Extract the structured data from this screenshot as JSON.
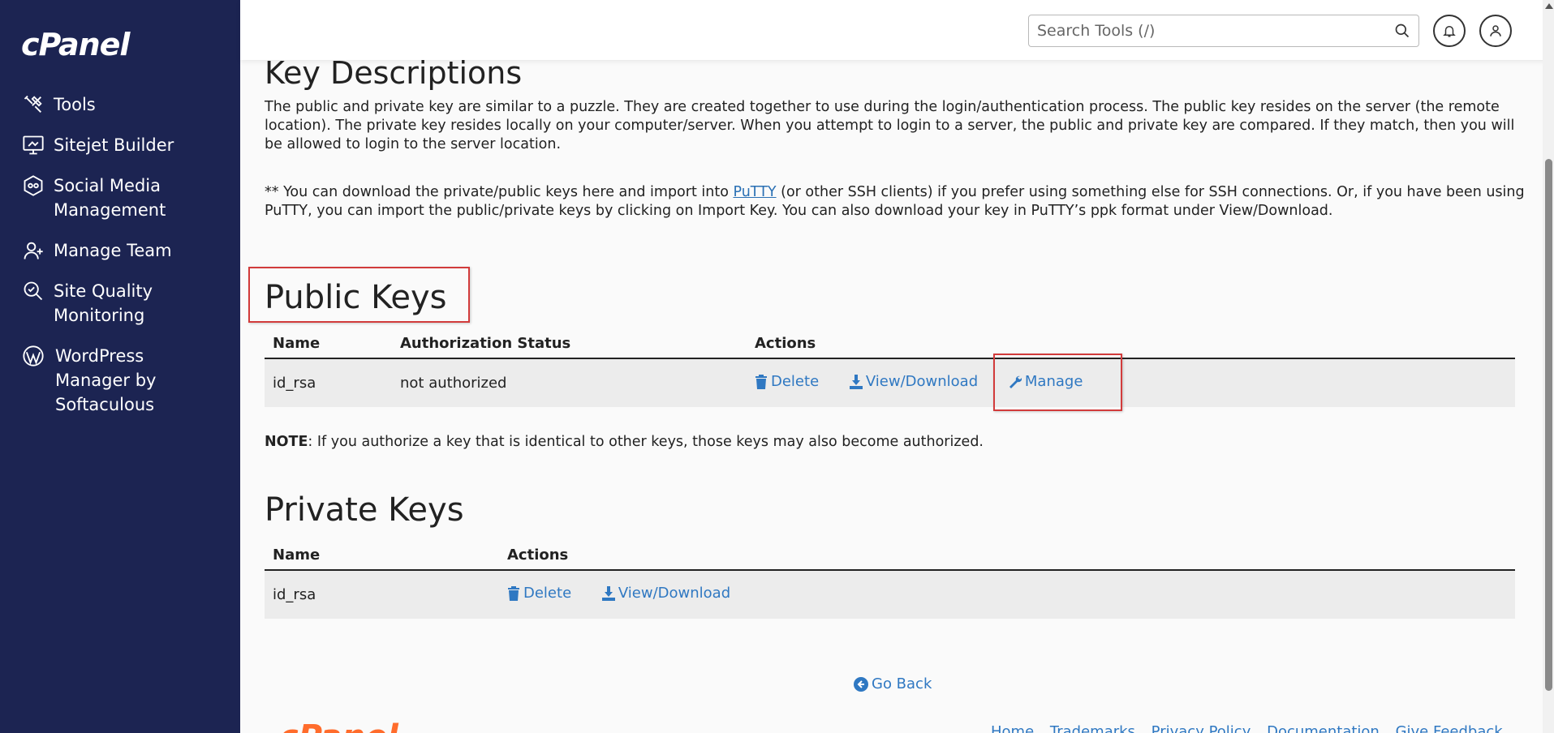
{
  "brand": {
    "logo": "cPanel"
  },
  "sidebar": {
    "items": [
      {
        "label": "Tools",
        "icon": "tools-icon"
      },
      {
        "label": "Sitejet Builder",
        "icon": "sitejet-icon"
      },
      {
        "label": "Social Media Management",
        "icon": "social-media-icon"
      },
      {
        "label": "Manage Team",
        "icon": "team-icon"
      },
      {
        "label": "Site Quality Monitoring",
        "icon": "site-quality-icon"
      },
      {
        "label": "WordPress Manager by Softaculous",
        "icon": "wordpress-icon"
      }
    ]
  },
  "header": {
    "search_placeholder": "Search Tools (/)"
  },
  "content": {
    "desc_title": "Key Descriptions",
    "desc_para1": "The public and private key are similar to a puzzle. They are created together to use during the login/authentication process. The public key resides on the server (the remote location). The private key resides locally on your computer/server. When you attempt to login to a server, the public and private key are compared. If they match, then you will be allowed to login to the server location.",
    "desc_para2_prefix": "** You can download the private/public keys here and import into ",
    "desc_para2_link": "PuTTY",
    "desc_para2_suffix": " (or other SSH clients) if you prefer using something else for SSH connections. Or, if you have been using PuTTY, you can import the public/private keys by clicking on Import Key. You can also download your key in PuTTY’s ppk format under View/Download.",
    "public_title": "Public Keys",
    "public_headers": {
      "name": "Name",
      "status": "Authorization Status",
      "actions": "Actions"
    },
    "public_rows": [
      {
        "name": "id_rsa",
        "status": "not authorized",
        "delete": "Delete",
        "view": "View/Download",
        "manage": "Manage"
      }
    ],
    "note_label": "NOTE",
    "note_text": ": If you authorize a key that is identical to other keys, those keys may also become authorized.",
    "private_title": "Private Keys",
    "private_headers": {
      "name": "Name",
      "actions": "Actions"
    },
    "private_rows": [
      {
        "name": "id_rsa",
        "delete": "Delete",
        "view": "View/Download"
      }
    ],
    "go_back": "Go Back"
  },
  "footer": {
    "logo": "cPanel",
    "links": [
      "Home",
      "Trademarks",
      "Privacy Policy",
      "Documentation",
      "Give Feedback"
    ]
  },
  "colors": {
    "sidebar": "#1c2452",
    "link": "#2f78c2",
    "highlight": "#d23b3b"
  }
}
